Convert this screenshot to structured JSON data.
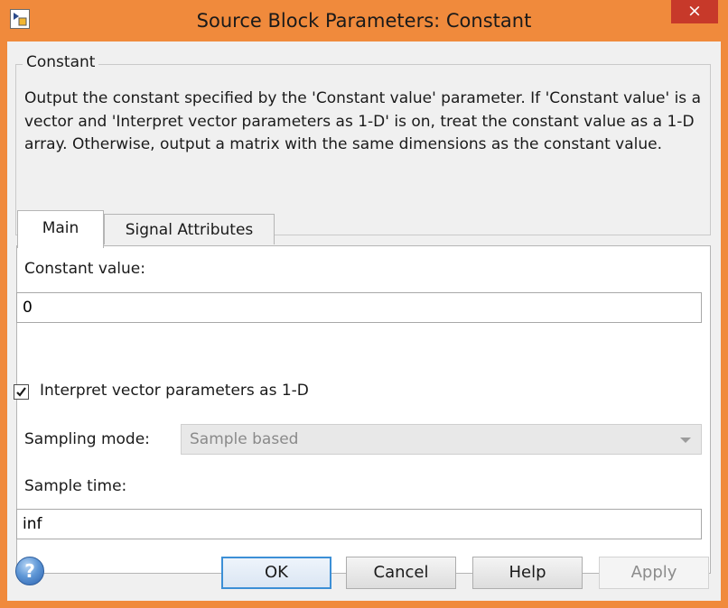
{
  "window": {
    "title": "Source Block Parameters: Constant",
    "close_glyph": "×",
    "app_icon": "simulink-block-icon",
    "accent_color": "#f08a3c"
  },
  "group": {
    "label": "Constant",
    "description": "Output the constant specified by the 'Constant value' parameter. If 'Constant value' is a vector and 'Interpret vector parameters as 1-D' is on, treat the constant value as a 1-D array. Otherwise, output a matrix with the same dimensions as the constant value."
  },
  "tabs": [
    {
      "label": "Main",
      "active": true
    },
    {
      "label": "Signal Attributes",
      "active": false
    }
  ],
  "main": {
    "constant_value_label": "Constant value:",
    "constant_value": "0",
    "interpret_checkbox_label": "Interpret vector parameters as 1-D",
    "interpret_checked": true,
    "sampling_mode_label": "Sampling mode:",
    "sampling_mode_value": "Sample based",
    "sampling_mode_enabled": false,
    "sample_time_label": "Sample time:",
    "sample_time_value": "inf"
  },
  "buttons": {
    "help_icon": "question-mark-icon",
    "help_glyph": "?",
    "ok": "OK",
    "cancel": "Cancel",
    "help": "Help",
    "apply": "Apply",
    "apply_enabled": false
  }
}
